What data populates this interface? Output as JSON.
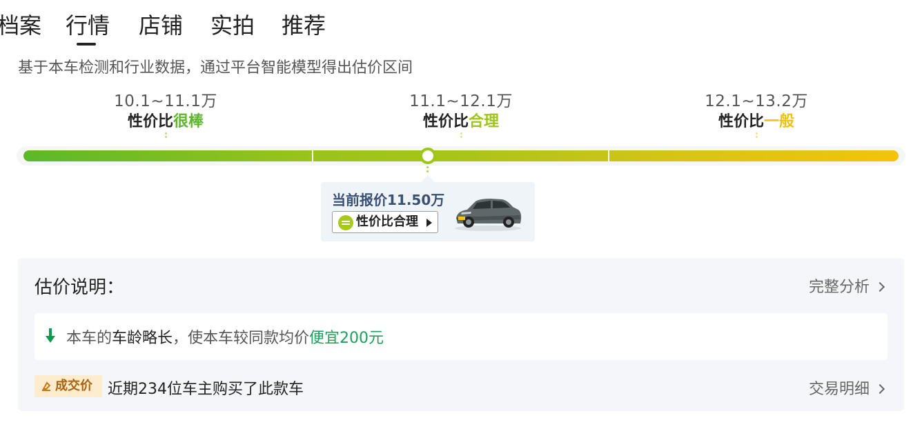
{
  "tabs": [
    {
      "label": "档案"
    },
    {
      "label": "行情",
      "active": true
    },
    {
      "label": "店铺"
    },
    {
      "label": "实拍"
    },
    {
      "label": "推荐"
    }
  ],
  "subtitle": "基于本车检测和行业数据，通过平台智能模型得出估价区间",
  "ranges": [
    {
      "price": "10.1~11.1万",
      "verdict_prefix": "性价比",
      "verdict_word": "很棒"
    },
    {
      "price": "11.1~12.1万",
      "verdict_prefix": "性价比",
      "verdict_word": "合理"
    },
    {
      "price": "12.1~13.2万",
      "verdict_prefix": "性价比",
      "verdict_word": "一般"
    }
  ],
  "current": {
    "price_text": "当前报价11.50万",
    "verdict_chip": "性价比合理"
  },
  "explanation": {
    "title": "估价说明：",
    "full_analysis_link": "完整分析",
    "reason_prefix": "本车的",
    "reason_strong": "车龄略长",
    "reason_middle": "，使本车较同款均价",
    "reason_highlight": "便宜200元",
    "deal_badge": "成交价",
    "deal_text": "近期234位车主购买了此款车",
    "deal_link": "交易明细"
  },
  "colors": {
    "good": "#5cb82a",
    "ok": "#9ec61a",
    "meh": "#f2c10c",
    "savings": "#1aa05a"
  }
}
